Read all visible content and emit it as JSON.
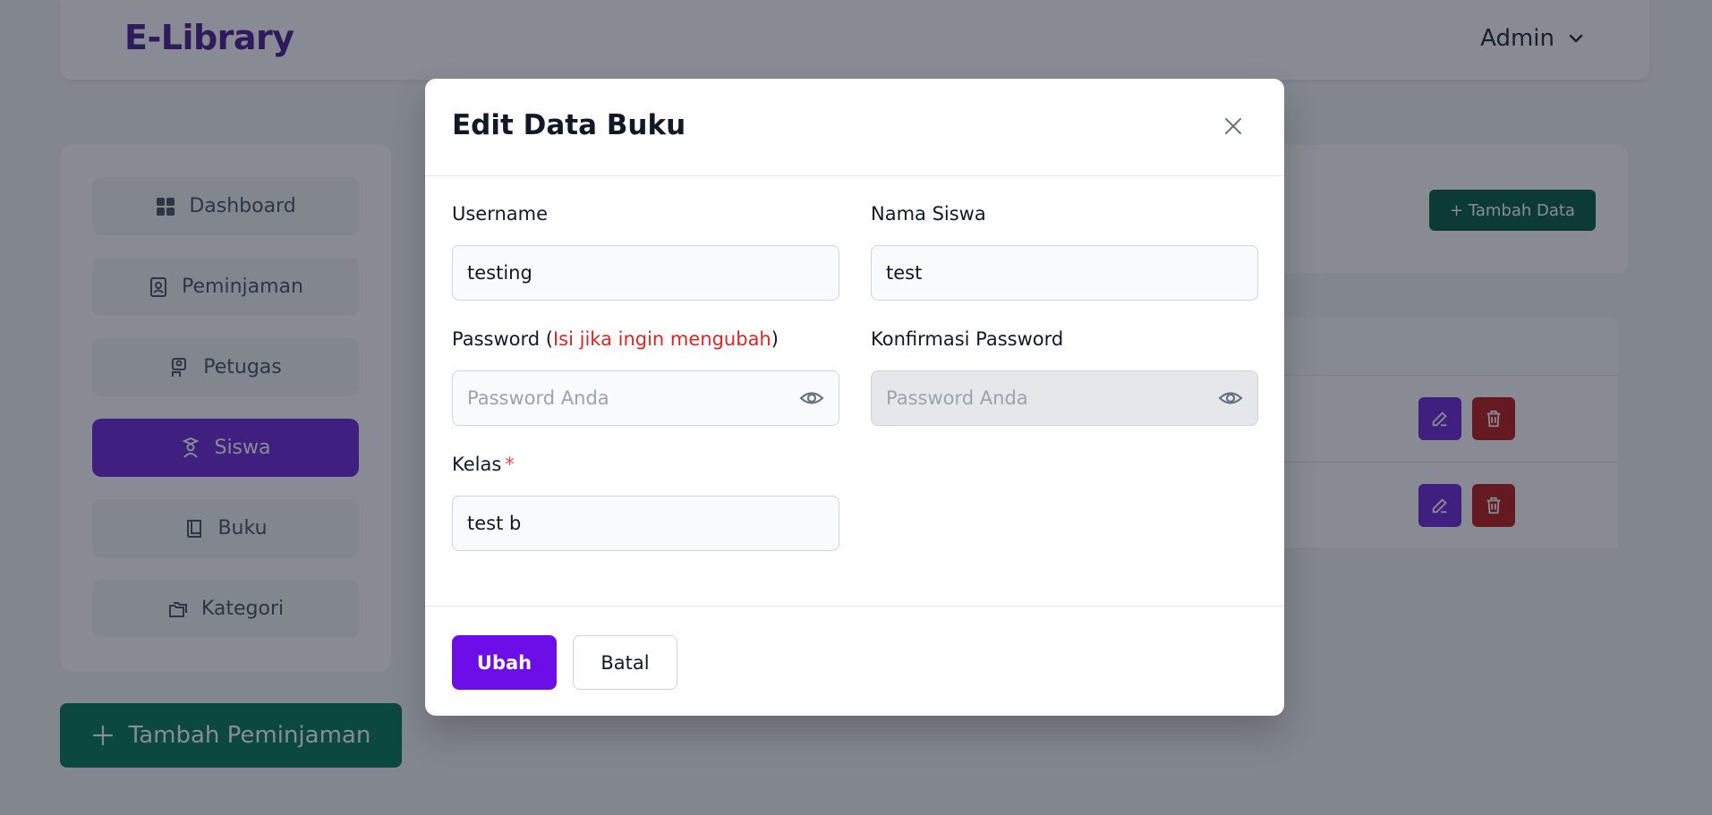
{
  "header": {
    "brand": "E-Library",
    "user_menu": "Admin"
  },
  "sidebar": {
    "items": [
      {
        "label": "Dashboard",
        "icon": "grid-icon"
      },
      {
        "label": "Peminjaman",
        "icon": "contact-book-icon"
      },
      {
        "label": "Petugas",
        "icon": "staff-icon"
      },
      {
        "label": "Siswa",
        "icon": "student-icon",
        "active": true
      },
      {
        "label": "Buku",
        "icon": "book-icon"
      },
      {
        "label": "Kategori",
        "icon": "folders-icon"
      }
    ],
    "add_loan_label": "Tambah Peminjaman"
  },
  "main": {
    "add_data_label": "+ Tambah Data"
  },
  "modal": {
    "title": "Edit Data Buku",
    "fields": {
      "username": {
        "label": "Username",
        "value": "testing"
      },
      "nama_siswa": {
        "label": "Nama Siswa",
        "value": "test"
      },
      "password": {
        "label": "Password (",
        "hint": "Isi jika ingin mengubah",
        "label_close": ")",
        "placeholder": "Password Anda"
      },
      "konfirmasi": {
        "label": "Konfirmasi Password",
        "placeholder": "Password Anda"
      },
      "kelas": {
        "label": "Kelas",
        "required_mark": "*",
        "value": "test b"
      }
    },
    "buttons": {
      "submit": "Ubah",
      "cancel": "Batal"
    }
  },
  "colors": {
    "brand": "#4c1d95",
    "primary": "#6d0ee8",
    "active_nav": "#6d28d9",
    "success": "#047857",
    "danger": "#b91c1c"
  }
}
